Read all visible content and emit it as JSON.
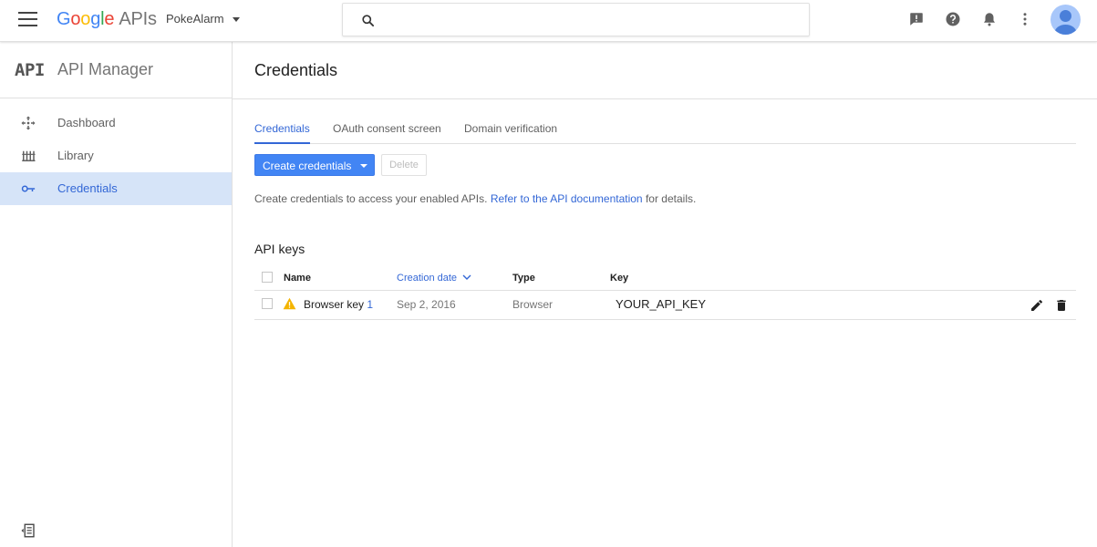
{
  "topbar": {
    "brand": "Google",
    "brand_suffix": "APIs",
    "project": "PokeAlarm",
    "search_value": "",
    "search_placeholder": "",
    "icons": [
      "feedback-icon",
      "help-icon",
      "notifications-icon",
      "more-vert-icon"
    ]
  },
  "sidebar": {
    "mark": "API",
    "title": "API Manager",
    "items": [
      {
        "label": "Dashboard",
        "icon": "dashboard-icon",
        "active": false
      },
      {
        "label": "Library",
        "icon": "library-icon",
        "active": false
      },
      {
        "label": "Credentials",
        "icon": "key-icon",
        "active": true
      }
    ]
  },
  "main": {
    "title": "Credentials",
    "tabs": [
      {
        "label": "Credentials",
        "active": true
      },
      {
        "label": "OAuth consent screen",
        "active": false
      },
      {
        "label": "Domain verification",
        "active": false
      }
    ],
    "create_button": "Create credentials",
    "delete_button": "Delete",
    "help_prefix": "Create credentials to access your enabled APIs.",
    "help_link": "Refer to the API documentation",
    "help_suffix": "for details.",
    "section_title": "API keys",
    "table": {
      "headers": [
        "Name",
        "Creation date",
        "Type",
        "Key"
      ],
      "rows": [
        {
          "name": "Browser key",
          "name_suffix": "1",
          "date": "Sep 2, 2016",
          "type": "Browser",
          "key": "YOUR_API_KEY"
        }
      ]
    }
  },
  "colors": {
    "accent": "#4285f4",
    "link": "#3367d6",
    "active_nav_bg": "#d6e4f8",
    "warning": "#f4b400"
  }
}
